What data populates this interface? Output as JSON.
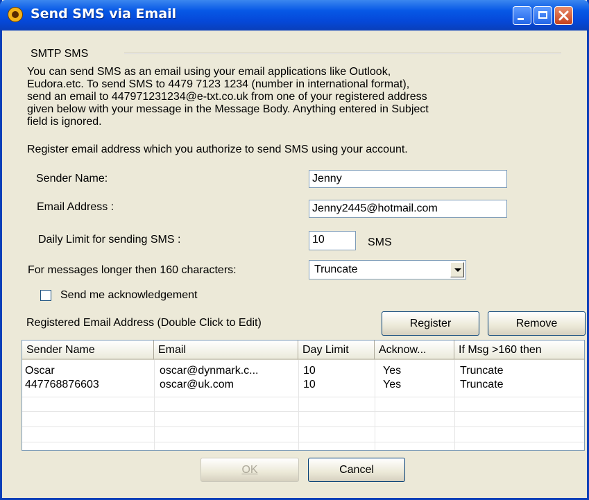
{
  "window": {
    "title": "Send SMS via Email"
  },
  "group": {
    "label": "SMTP SMS"
  },
  "intro": {
    "line1": "You can send SMS as an email using your email applications like Outlook,",
    "line2": "Eudora.etc. To send SMS to 4479 7123 1234 (number in international format),",
    "line3": "send an email to 447971231234@e-txt.co.uk from one of your registered address",
    "line4": "given below with your message in the Message Body. Anything entered in Subject",
    "line5": "field is ignored."
  },
  "register_prompt": "Register email address which you authorize to send SMS  using your account.",
  "form": {
    "sender_name_label": "Sender Name:",
    "sender_name_value": "Jenny",
    "email_label": "Email Address :",
    "email_value": "Jenny2445@hotmail.com",
    "daily_limit_label": "Daily Limit for sending SMS :",
    "daily_limit_value": "10",
    "daily_limit_unit": "SMS",
    "long_msg_label": "For messages longer then 160 characters:",
    "long_msg_value": "Truncate",
    "ack_label": "Send me acknowledgement",
    "ack_checked": false
  },
  "registered": {
    "label": "Registered Email Address (Double Click to Edit)",
    "register_button": "Register",
    "remove_button": "Remove",
    "columns": [
      "Sender Name",
      "Email",
      "Day Limit",
      "Acknow...",
      "If Msg >160 then"
    ],
    "rows": [
      [
        "Oscar",
        "oscar@dynmark.c...",
        "10",
        "Yes",
        "Truncate"
      ],
      [
        "447768876603",
        "oscar@uk.com",
        "10",
        "Yes",
        "Truncate"
      ]
    ]
  },
  "footer": {
    "ok_label": "OK",
    "cancel_label": "Cancel"
  },
  "icons": {
    "app": "app-logo-icon",
    "minimize": "minimize-icon",
    "maximize": "maximize-icon",
    "close": "close-icon",
    "dropdown": "chevron-down-icon"
  },
  "colors": {
    "titlebar": "#0758e6",
    "dialog_bg": "#ece9d8",
    "close_button": "#c6401c"
  }
}
